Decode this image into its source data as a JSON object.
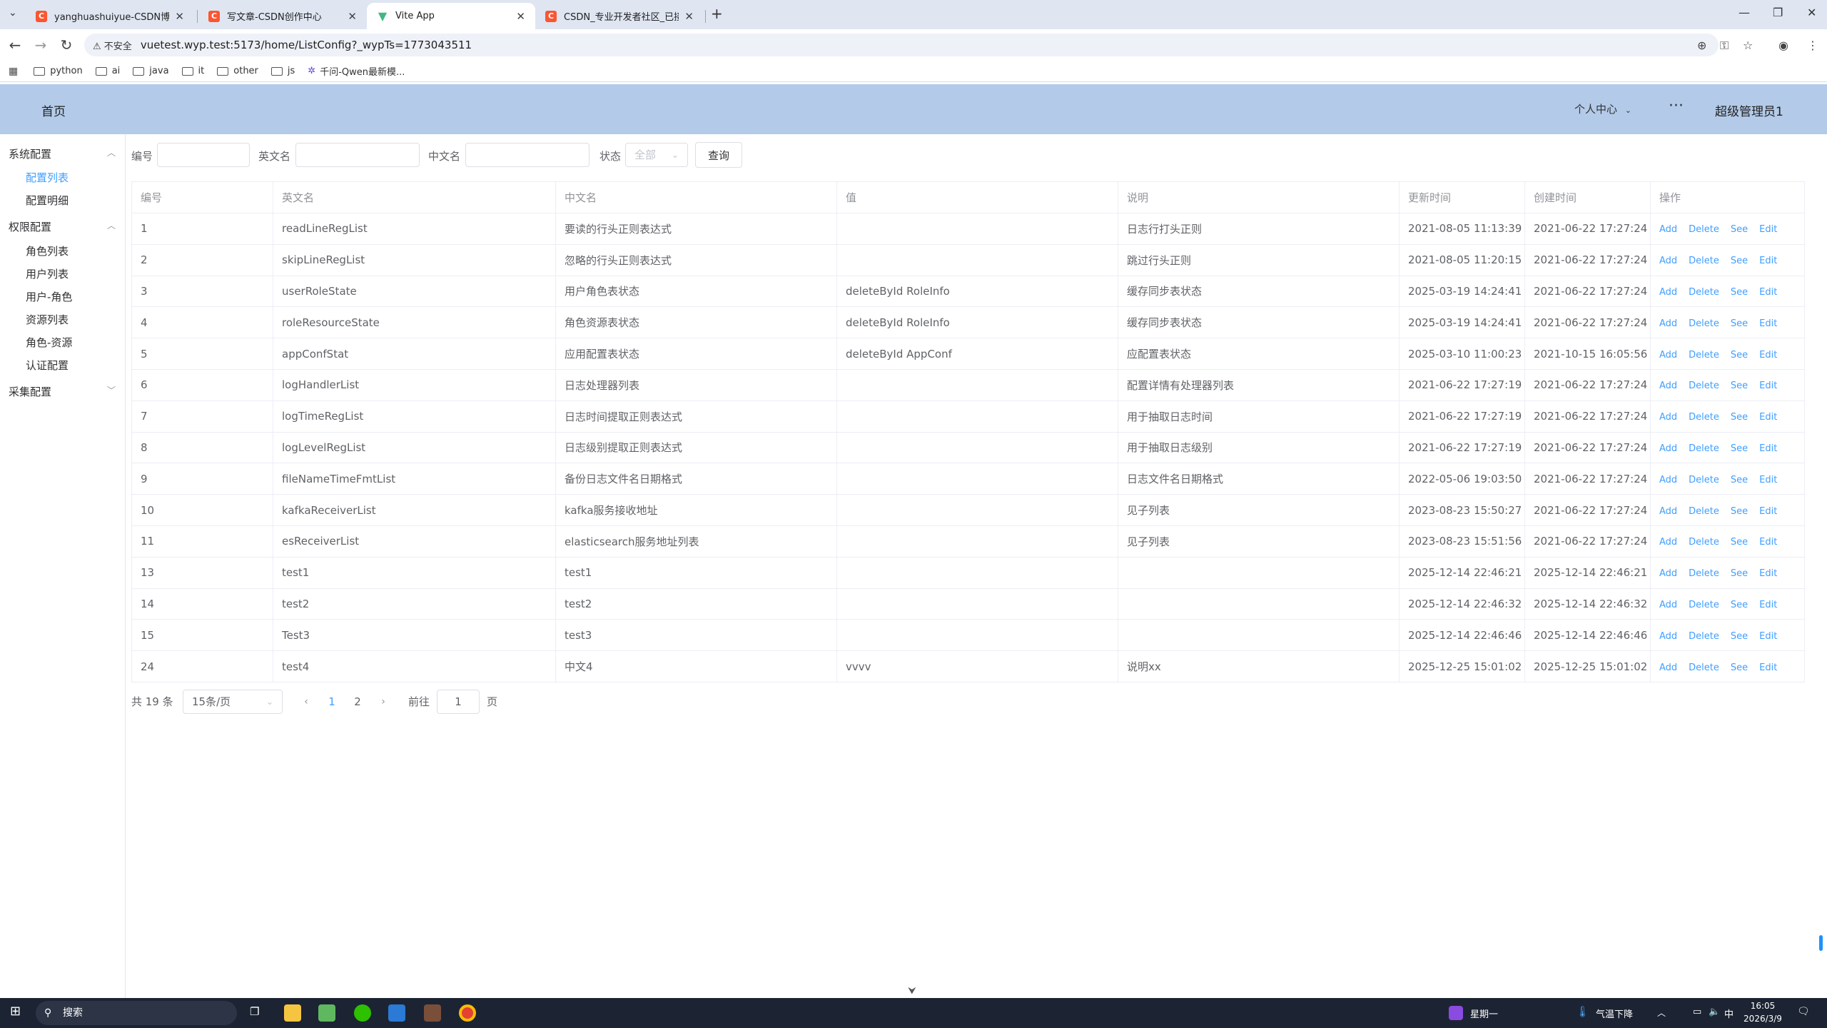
{
  "browser": {
    "tabs": [
      {
        "label": "yanghuashuiyue-CSDN博客",
        "favicon": "csdn-icon",
        "active": false
      },
      {
        "label": "写文章-CSDN创作中心",
        "favicon": "csdn-icon",
        "active": false
      },
      {
        "label": "Vite App",
        "favicon": "vite-icon",
        "active": true
      },
      {
        "label": "CSDN_专业开发者社区_已接入",
        "favicon": "csdn-icon",
        "active": false
      }
    ],
    "security_label": "不安全",
    "url": "vuetest.wyp.test:5173/home/ListConfig?_wypTs=1773043511",
    "bookmarks": [
      {
        "label": "python"
      },
      {
        "label": "ai"
      },
      {
        "label": "java"
      },
      {
        "label": "it"
      },
      {
        "label": "other"
      },
      {
        "label": "js"
      },
      {
        "label": "千问-Qwen最新模..."
      }
    ]
  },
  "header": {
    "home": "首页",
    "center": "个人中心",
    "more": "···",
    "user": "超级管理员1"
  },
  "sidebar": {
    "groups": [
      {
        "label": "系统配置",
        "items": [
          "配置列表",
          "配置明细"
        ]
      },
      {
        "label": "权限配置",
        "items": [
          "角色列表",
          "用户列表",
          "用户-角色",
          "资源列表",
          "角色-资源",
          "认证配置"
        ]
      },
      {
        "label": "采集配置",
        "items": []
      }
    ],
    "active": "配置列表"
  },
  "filters": {
    "id_label": "编号",
    "en_label": "英文名",
    "cn_label": "中文名",
    "status_label": "状态",
    "status_value": "全部",
    "query_button": "查询"
  },
  "table": {
    "headers": [
      "编号",
      "英文名",
      "中文名",
      "值",
      "说明",
      "更新时间",
      "创建时间",
      "操作"
    ],
    "actions": [
      "Add",
      "Delete",
      "See",
      "Edit"
    ],
    "rows": [
      [
        "1",
        "readLineRegList",
        "要读的行头正则表达式",
        "",
        "日志行打头正则",
        "2021-08-05 11:13:39",
        "2021-06-22 17:27:24"
      ],
      [
        "2",
        "skipLineRegList",
        "忽略的行头正则表达式",
        "",
        "跳过行头正则",
        "2021-08-05 11:20:15",
        "2021-06-22 17:27:24"
      ],
      [
        "3",
        "userRoleState",
        "用户角色表状态",
        "deleteById RoleInfo",
        "缓存同步表状态",
        "2025-03-19 14:24:41",
        "2021-06-22 17:27:24"
      ],
      [
        "4",
        "roleResourceState",
        "角色资源表状态",
        "deleteById RoleInfo",
        "缓存同步表状态",
        "2025-03-19 14:24:41",
        "2021-06-22 17:27:24"
      ],
      [
        "5",
        "appConfStat",
        "应用配置表状态",
        "deleteById AppConf",
        "应配置表状态",
        "2025-03-10 11:00:23",
        "2021-10-15 16:05:56"
      ],
      [
        "6",
        "logHandlerList",
        "日志处理器列表",
        "",
        "配置详情有处理器列表",
        "2021-06-22 17:27:19",
        "2021-06-22 17:27:24"
      ],
      [
        "7",
        "logTimeRegList",
        "日志时间提取正则表达式",
        "",
        "用于抽取日志时间",
        "2021-06-22 17:27:19",
        "2021-06-22 17:27:24"
      ],
      [
        "8",
        "logLevelRegList",
        "日志级别提取正则表达式",
        "",
        "用于抽取日志级别",
        "2021-06-22 17:27:19",
        "2021-06-22 17:27:24"
      ],
      [
        "9",
        "fileNameTimeFmtList",
        "备份日志文件名日期格式",
        "",
        "日志文件名日期格式",
        "2022-05-06 19:03:50",
        "2021-06-22 17:27:24"
      ],
      [
        "10",
        "kafkaReceiverList",
        "kafka服务接收地址",
        "",
        "见子列表",
        "2023-08-23 15:50:27",
        "2021-06-22 17:27:24"
      ],
      [
        "11",
        "esReceiverList",
        "elasticsearch服务地址列表",
        "",
        "见子列表",
        "2023-08-23 15:51:56",
        "2021-06-22 17:27:24"
      ],
      [
        "13",
        "test1",
        "test1",
        "",
        "",
        "2025-12-14 22:46:21",
        "2025-12-14 22:46:21"
      ],
      [
        "14",
        "test2",
        "test2",
        "",
        "",
        "2025-12-14 22:46:32",
        "2025-12-14 22:46:32"
      ],
      [
        "15",
        "Test3",
        "test3",
        "",
        "",
        "2025-12-14 22:46:46",
        "2025-12-14 22:46:46"
      ],
      [
        "24",
        "test4",
        "中文4",
        "vvvv",
        "说明xx",
        "2025-12-25 15:01:02",
        "2025-12-25 15:01:02"
      ]
    ]
  },
  "pagination": {
    "total": "共 19 条",
    "page_size": "15条/页",
    "pages": [
      "1",
      "2"
    ],
    "current": "1",
    "goto_label": "前往",
    "goto_value": "1",
    "page_suffix": "页"
  },
  "taskbar": {
    "search": "搜索",
    "weekday": "星期一",
    "weather": "气温下降",
    "ime": "中",
    "time": "16:05",
    "date": "2026/3/9"
  },
  "colors": {
    "header_bg": "#b3cbe9",
    "accent": "#409eff",
    "taskbar_bg": "#1c2433"
  }
}
